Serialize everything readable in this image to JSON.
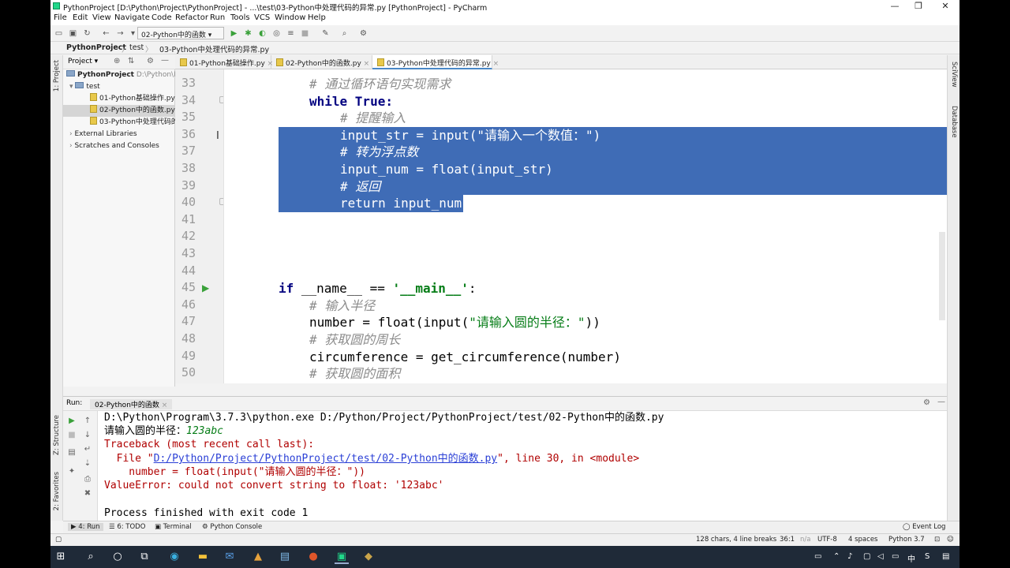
{
  "window": {
    "title": "PythonProject [D:\\Python\\Project\\PythonProject] - ...\\test\\03-Python中处理代码的异常.py [PythonProject] - PyCharm",
    "minimize": "—",
    "maximize": "❐",
    "close": "✕"
  },
  "menu": [
    "File",
    "Edit",
    "View",
    "Navigate",
    "Code",
    "Refactor",
    "Run",
    "Tools",
    "VCS",
    "Window",
    "Help"
  ],
  "toolbar": {
    "run_config": "02-Python中的函数"
  },
  "breadcrumb": [
    "PythonProject",
    "test",
    "03-Python中处理代码的异常.py"
  ],
  "left_strip": {
    "project": "1: Project",
    "structure": "Z: Structure",
    "favorites": "2: Favorites"
  },
  "right_strip": {
    "sciview": "SciView",
    "database": "Database"
  },
  "project_panel": {
    "header": "Project",
    "items": [
      {
        "label": "PythonProject",
        "path": "D:\\Python\\Pro",
        "kind": "root"
      },
      {
        "label": "test",
        "kind": "folder"
      },
      {
        "label": "01-Python基础操作.py",
        "kind": "file"
      },
      {
        "label": "02-Python中的函数.py",
        "kind": "file",
        "selected": true
      },
      {
        "label": "03-Python中处理代码的",
        "kind": "file"
      },
      {
        "label": "External Libraries",
        "kind": "lib"
      },
      {
        "label": "Scratches and Consoles",
        "kind": "scratch"
      }
    ]
  },
  "editor_tabs": [
    {
      "label": "01-Python基础操作.py",
      "active": false
    },
    {
      "label": "02-Python中的函数.py",
      "active": false
    },
    {
      "label": "03-Python中处理代码的异常.py",
      "active": true
    }
  ],
  "line_numbers": [
    "33",
    "34",
    "35",
    "36",
    "37",
    "38",
    "39",
    "40",
    "41",
    "42",
    "43",
    "44",
    "45",
    "46",
    "47",
    "48",
    "49",
    "50"
  ],
  "code": {
    "l33": "# 通过循环语句实现需求",
    "l34_kw": "while True:",
    "l35": "# 提醒输入",
    "l36": "input_str = input(\"请输入一个数值：\")",
    "l37": "# 转为浮点数",
    "l38": "input_num = float(input_str)",
    "l39": "# 返回",
    "l40": "return input_num",
    "l45_a": "if",
    "l45_b": " __name__ == ",
    "l45_c": "'__main__'",
    "l45_d": ":",
    "l46": "# 输入半径",
    "l47_a": "number = float(input(",
    "l47_b": "\"请输入圆的半径：\"",
    "l47_c": "))",
    "l48": "# 获取圆的周长",
    "l49": "circumference = get_circumference(number)",
    "l50": "# 获取圆的面积"
  },
  "run_panel": {
    "label": "Run:",
    "tab": "02-Python中的函数",
    "output": {
      "cmd": "D:\\Python\\Program\\3.7.3\\python.exe D:/Python/Project/PythonProject/test/02-Python中的函数.py",
      "prompt": "请输入圆的半径：",
      "input": "123abc",
      "traceback": "Traceback (most recent call last):",
      "file_prefix": "  File \"",
      "file_link": "D:/Python/Project/PythonProject/test/02-Python中的函数.py",
      "file_suffix": "\", line 30, in <module>",
      "code_line": "    number = float(input(\"请输入圆的半径：\"))",
      "error": "ValueError: could not convert string to float: '123abc'",
      "finished": "Process finished with exit code 1"
    }
  },
  "bottom_tabs": [
    "4: Run",
    "6: TODO",
    "Terminal",
    "Python Console"
  ],
  "event_log": "Event Log",
  "status": {
    "chars": "128 chars, 4 line breaks",
    "position": "36:1",
    "na": "n/a",
    "encoding": "UTF-8",
    "indent": "4 spaces",
    "interpreter": "Python 3.7"
  },
  "taskbar": {
    "ime": "中",
    "ime2": "S"
  },
  "colors": {
    "selection": "#3f6cb6",
    "keyword": "#000080",
    "string": "#067d17",
    "comment": "#8c8c8c"
  }
}
